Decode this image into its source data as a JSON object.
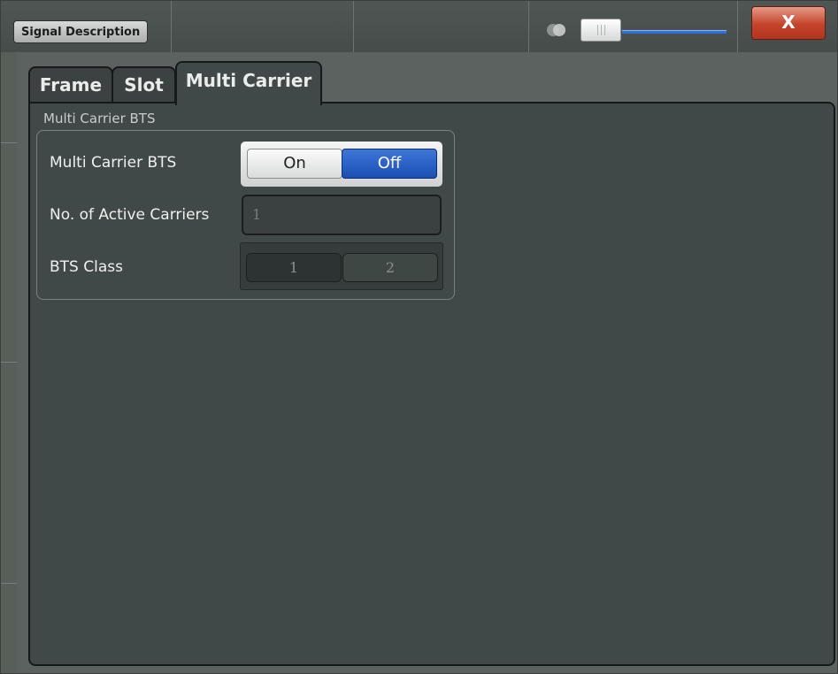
{
  "window": {
    "title": "Signal Description",
    "close_label": "X"
  },
  "tabs": [
    {
      "label": "Frame",
      "active": false
    },
    {
      "label": "Slot",
      "active": false
    },
    {
      "label": "Multi Carrier",
      "active": true
    }
  ],
  "group": {
    "title": "Multi Carrier BTS",
    "multi_carrier_bts": {
      "label": "Multi Carrier BTS",
      "on_label": "On",
      "off_label": "Off",
      "selected": "Off"
    },
    "active_carriers": {
      "label": "No. of Active Carriers",
      "value": "1"
    },
    "bts_class": {
      "label": "BTS Class",
      "options": [
        "1",
        "2"
      ],
      "selected": "1"
    }
  },
  "colors": {
    "selected_blue": "#1b4fb3",
    "close_red": "#c4432b"
  }
}
